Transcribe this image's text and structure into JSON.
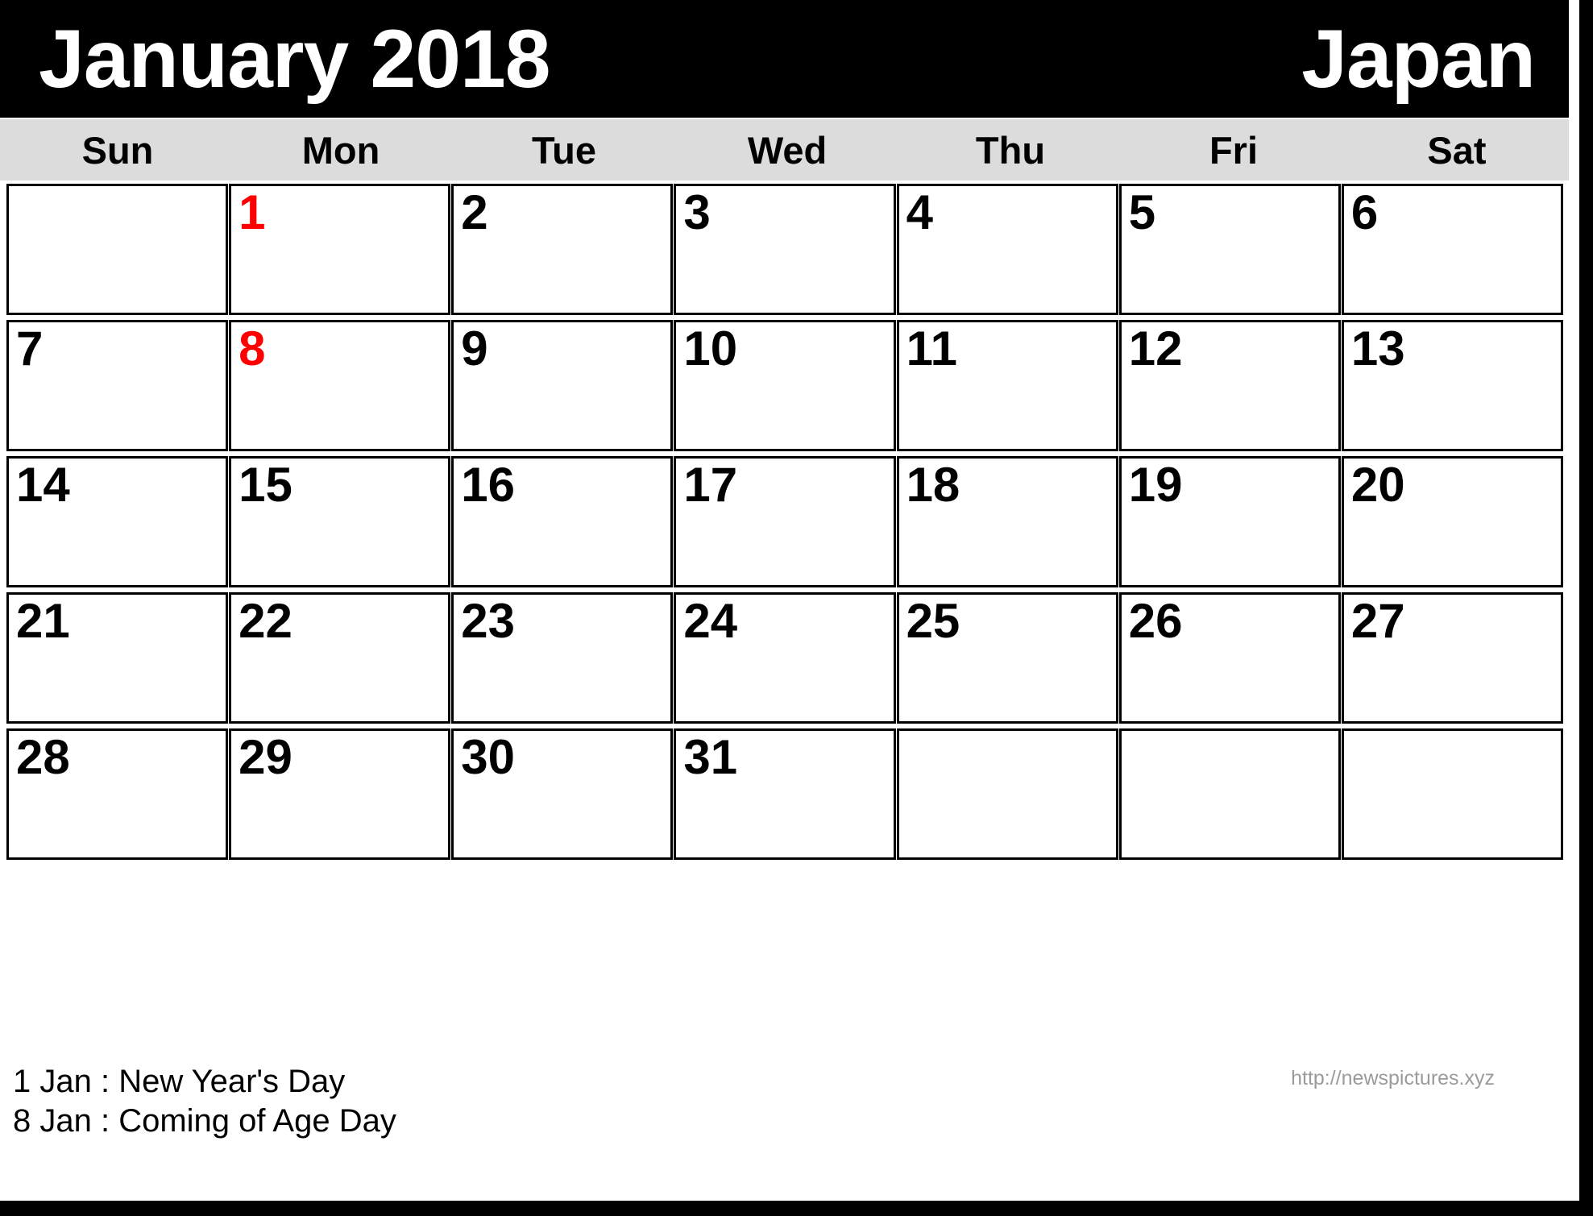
{
  "header": {
    "month_year": "January 2018",
    "country": "Japan",
    "background_color": "#000000",
    "text_color": "#ffffff"
  },
  "weekdays": [
    {
      "label": "Sun"
    },
    {
      "label": "Mon"
    },
    {
      "label": "Tue"
    },
    {
      "label": "Wed"
    },
    {
      "label": "Thu"
    },
    {
      "label": "Fri"
    },
    {
      "label": "Sat"
    }
  ],
  "weekday_row": {
    "background_color": "#dcdcdc",
    "text_color": "#000000"
  },
  "colors": {
    "holiday": "#ff0000",
    "weekday_text": "#000000",
    "cell_border": "#000000",
    "cell_background": "#ffffff",
    "watermark": "#9b9b9b"
  },
  "weeks": [
    [
      {
        "day": "",
        "holiday": false
      },
      {
        "day": "1",
        "holiday": true
      },
      {
        "day": "2",
        "holiday": false
      },
      {
        "day": "3",
        "holiday": false
      },
      {
        "day": "4",
        "holiday": false
      },
      {
        "day": "5",
        "holiday": false
      },
      {
        "day": "6",
        "holiday": false
      }
    ],
    [
      {
        "day": "7",
        "holiday": false
      },
      {
        "day": "8",
        "holiday": true
      },
      {
        "day": "9",
        "holiday": false
      },
      {
        "day": "10",
        "holiday": false
      },
      {
        "day": "11",
        "holiday": false
      },
      {
        "day": "12",
        "holiday": false
      },
      {
        "day": "13",
        "holiday": false
      }
    ],
    [
      {
        "day": "14",
        "holiday": false
      },
      {
        "day": "15",
        "holiday": false
      },
      {
        "day": "16",
        "holiday": false
      },
      {
        "day": "17",
        "holiday": false
      },
      {
        "day": "18",
        "holiday": false
      },
      {
        "day": "19",
        "holiday": false
      },
      {
        "day": "20",
        "holiday": false
      }
    ],
    [
      {
        "day": "21",
        "holiday": false
      },
      {
        "day": "22",
        "holiday": false
      },
      {
        "day": "23",
        "holiday": false
      },
      {
        "day": "24",
        "holiday": false
      },
      {
        "day": "25",
        "holiday": false
      },
      {
        "day": "26",
        "holiday": false
      },
      {
        "day": "27",
        "holiday": false
      }
    ],
    [
      {
        "day": "28",
        "holiday": false
      },
      {
        "day": "29",
        "holiday": false
      },
      {
        "day": "30",
        "holiday": false
      },
      {
        "day": "31",
        "holiday": false
      },
      {
        "day": "",
        "holiday": false
      },
      {
        "day": "",
        "holiday": false
      },
      {
        "day": "",
        "holiday": false
      }
    ]
  ],
  "footer": {
    "holidays": [
      {
        "text": "1 Jan : New Year's Day"
      },
      {
        "text": "8 Jan : Coming of Age Day"
      }
    ],
    "watermark": "http://newspictures.xyz"
  }
}
